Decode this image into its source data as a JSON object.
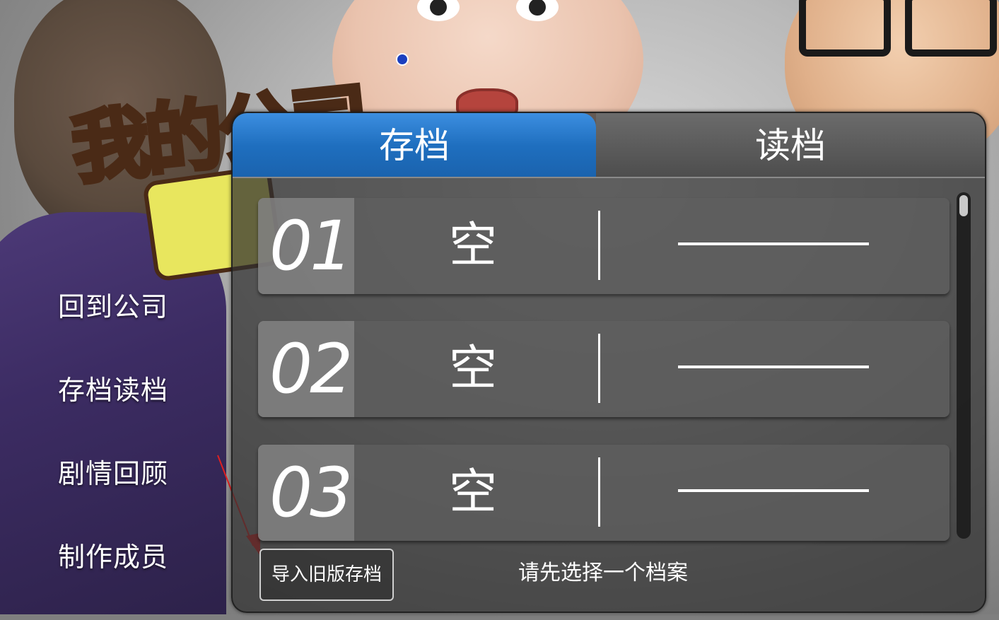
{
  "logo": {
    "text": "我的公司",
    "number": "9"
  },
  "side_menu": {
    "items": [
      {
        "label": "回到公司"
      },
      {
        "label": "存档读档"
      },
      {
        "label": "剧情回顾"
      },
      {
        "label": "制作成员"
      }
    ]
  },
  "panel": {
    "tabs": [
      {
        "label": "存档",
        "active": true
      },
      {
        "label": "读档",
        "active": false
      }
    ],
    "slots": [
      {
        "number": "01",
        "status": "空"
      },
      {
        "number": "02",
        "status": "空"
      },
      {
        "number": "03",
        "status": "空"
      }
    ],
    "import_button": "导入旧版存档",
    "hint": "请先选择一个档案"
  },
  "colors": {
    "active_tab": "#1f6fbf",
    "inactive_tab": "#4d4d4d",
    "arrow": "#e02020"
  }
}
